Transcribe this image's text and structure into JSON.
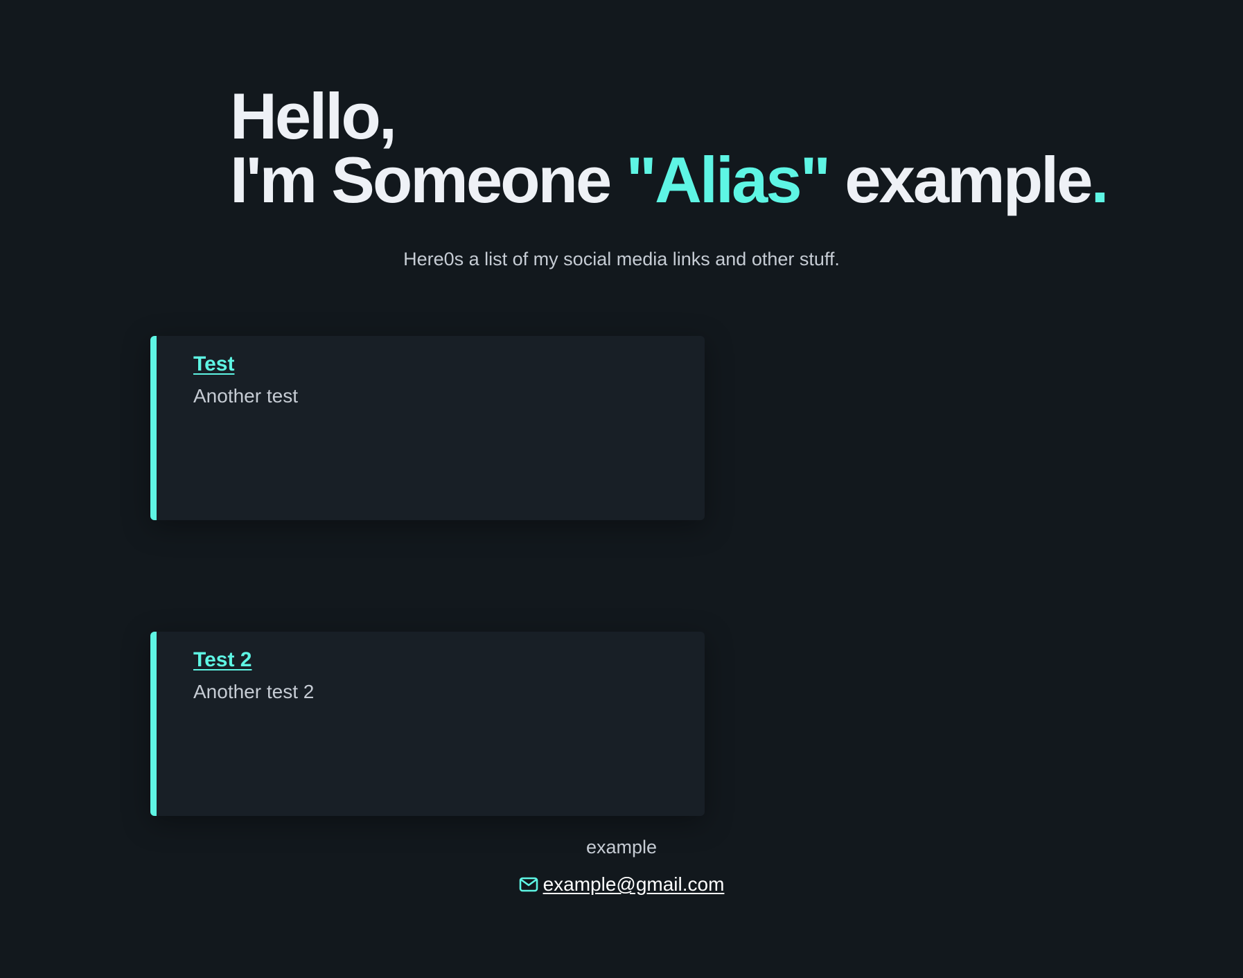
{
  "colors": {
    "background": "#12181d",
    "accent": "#5ef5e4",
    "card_background": "#181f26",
    "text": "#eef1f6",
    "muted_text": "#c6ccd4"
  },
  "hero": {
    "line1": "Hello,",
    "line2_prefix": "I'm Someone ",
    "alias": "\"Alias\"",
    "line2_suffix": " example",
    "period": "."
  },
  "subtitle": "Here0s a list of my social media links and other stuff.",
  "cards": [
    {
      "title": "Test",
      "description": "Another test"
    },
    {
      "title": "Test 2",
      "description": "Another test 2"
    }
  ],
  "footer": {
    "name": "example",
    "email_icon": "mail-icon",
    "email": "example@gmail.com"
  }
}
